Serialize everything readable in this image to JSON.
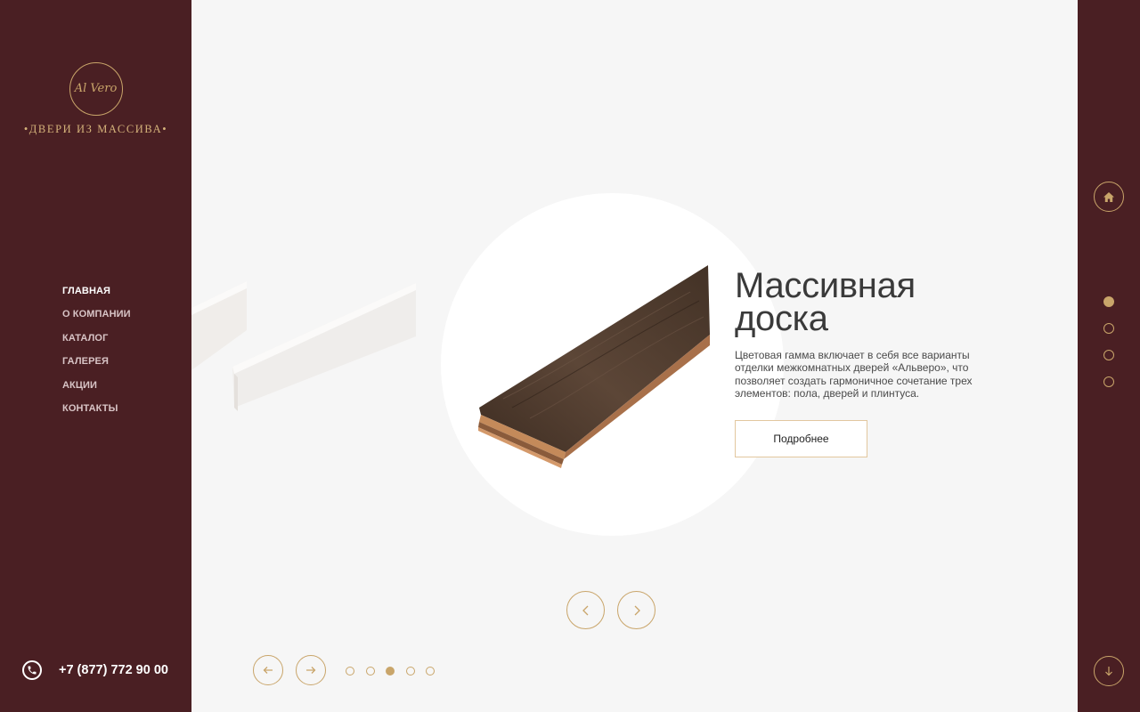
{
  "brand": {
    "logo_monogram": "Al Vero",
    "tagline": "•ДВЕРИ ИЗ МАССИВА•"
  },
  "nav": {
    "items": [
      {
        "label": "ГЛАВНАЯ",
        "active": true
      },
      {
        "label": "О КОМПАНИИ",
        "active": false
      },
      {
        "label": "КАТАЛОГ",
        "active": false
      },
      {
        "label": "ГАЛЕРЕЯ",
        "active": false
      },
      {
        "label": "АКЦИИ",
        "active": false
      },
      {
        "label": "КОНТАКТЫ",
        "active": false
      }
    ]
  },
  "contact": {
    "phone": "+7 (877) 772 90 00",
    "icon": "phone-icon"
  },
  "slide": {
    "title_line1": "Массивная",
    "title_line2": "доска",
    "description": "Цветовая гамма включает в себя все варианты отделки межкомнатных дверей «Альверо», что позволяет создать гармоничное сочетание трех элементов: пола, дверей и плинтуса.",
    "more_button": "Подробнее"
  },
  "carousel": {
    "slide_count": 5,
    "active_slide": 3
  },
  "section_nav": {
    "count": 4,
    "active": 1,
    "home_icon": "home-icon",
    "down_icon": "arrow-down-icon"
  },
  "colors": {
    "sidebar": "#4a1f23",
    "accent_gold": "#c9a56a",
    "background": "#f6f6f6"
  }
}
